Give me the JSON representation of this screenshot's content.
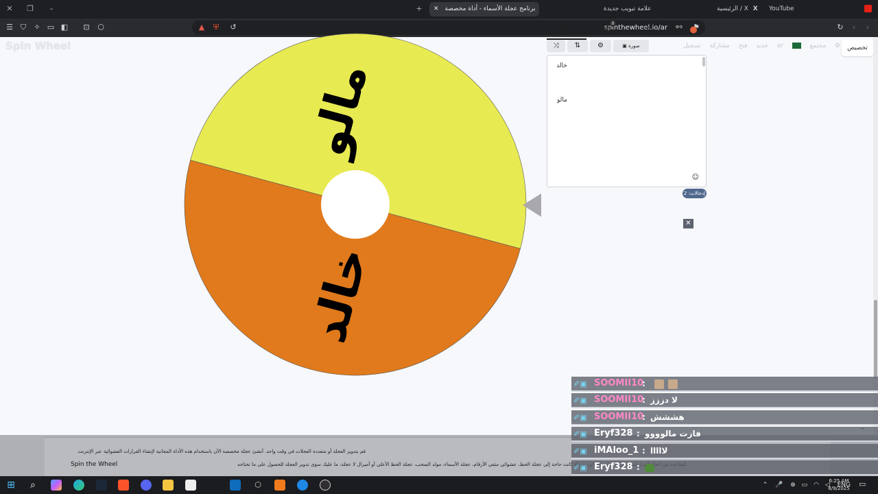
{
  "tabs": [
    {
      "label": "YouTube",
      "favicon_color": "#ff0000"
    },
    {
      "label": "الرئيسية / X",
      "favicon_color": "#ffffff"
    },
    {
      "label": "علامة تبويب جديدة",
      "favicon_color": ""
    },
    {
      "label": "برنامج عجلة الأسماء - أداة مخصصة",
      "favicon_color": "#e84d7a",
      "active": true
    }
  ],
  "window": {
    "close_glyph": "✕",
    "restore_glyph": "❐",
    "minimize_glyph": "–",
    "new_tab_glyph": "+",
    "tab_close_glyph": "✕"
  },
  "address_bar": {
    "url": "spinthewheel.io/ar"
  },
  "site": {
    "logo": "Spin Wheel",
    "menu": [
      "جديد",
      "فتح",
      "مشاركة",
      "تسجيل",
      "ar",
      "مجتمع"
    ],
    "customize_button": "تخصيص"
  },
  "wheel": {
    "segments": [
      {
        "label": "مالو",
        "color": "#e8ea52"
      },
      {
        "label": "خالد",
        "color": "#e07a1c"
      }
    ]
  },
  "editor": {
    "tabs": [
      {
        "icon": "palette-icon",
        "glyph": "●"
      },
      {
        "icon": "plus-icon",
        "glyph": "+"
      },
      {
        "icon": "hide-icon",
        "glyph": "◌"
      },
      {
        "icon": "results-icon",
        "glyph": "▤",
        "badge": "0"
      },
      {
        "icon": "pencil-icon",
        "glyph": "✎"
      }
    ],
    "tools": {
      "image_label": "▣ صورة",
      "settings_glyph": "⚙",
      "sort_glyph": "⇅",
      "shuffle_glyph": "⤨"
    },
    "entries": [
      "خالد",
      "مالو"
    ],
    "emoji_glyph": "☺",
    "count_badge": "إدخالات: 2"
  },
  "ad_close_glyph": "✕",
  "footer": {
    "line1": "قم بتدوير العجلة أو متعددة العجلات في وقت واحد. أنشئ عجلة مخصصة الآن باستخدام هذه الأداة المجانية لإنشاء القرارات العشوائية عبر الإنترنت",
    "line2": "الشاعدة في اتخاذ القرار عند إجراء اختيار عشوائي، سواء كانت حاجة إلى عجلة الحظ، عشوائي متقي الأرقام، عجلة الأسماء، مولد السحب، عجلة الحظ الأعلى أو أميرال لا عجلة، ما عليك سوى تدوير العجلة للحصول على ما تحتاجه",
    "brand": "Spin the Wheel",
    "chevron": "⌄"
  },
  "chat": [
    {
      "user": "SOOMII10",
      "user_color": "#ff88c8",
      "message": "",
      "emotes": 2
    },
    {
      "user": "SOOMII10",
      "user_color": "#ff88c8",
      "message": "لا دززز"
    },
    {
      "user": "SOOMII10",
      "user_color": "#ff88c8",
      "message": "هششش"
    },
    {
      "user": "Eryf328",
      "user_color": "#ffffff",
      "message": "فازت مالوووو"
    },
    {
      "user": "iMAloo_1",
      "user_color": "#ffffff",
      "message": "لااااا"
    },
    {
      "user": "Eryf328",
      "user_color": "#ffffff",
      "message": "",
      "frog": true
    },
    {
      "user": "Eryf328",
      "user_color": "#ffffff",
      "message": "",
      "frog": true
    }
  ],
  "taskbar": {
    "start_glyph": "⊞",
    "search_glyph": "⌕",
    "apps": [
      "copilot",
      "edge",
      "steam",
      "brave",
      "discord",
      "explorer",
      "store",
      "outlook",
      "settings",
      "vlc-like",
      "bluetooth-app",
      "obs"
    ],
    "tray_lang": "ENG",
    "time": "6:25 AM",
    "date": "8/9/2025"
  }
}
